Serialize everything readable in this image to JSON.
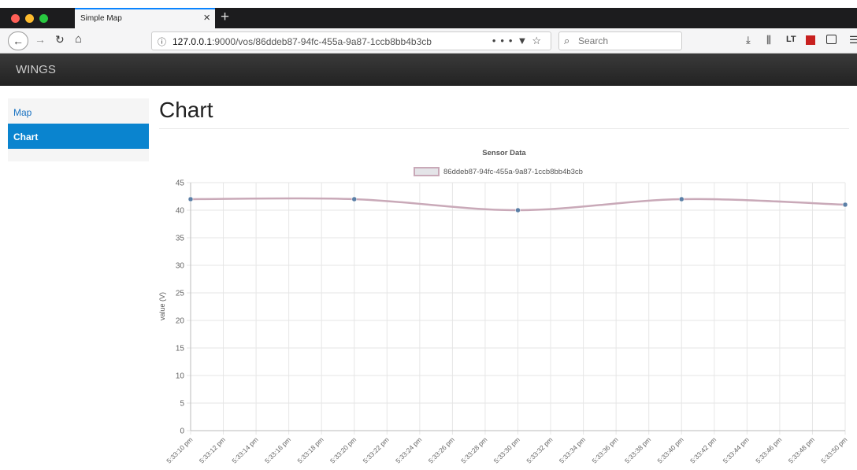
{
  "browser": {
    "tab_title": "Simple Map",
    "tab_close": "×",
    "new_tab": "+",
    "url_host": "127.0.0.1",
    "url_rest": ":9000/vos/86ddeb87-94fc-455a-9a87-1ccb8bb4b3cb",
    "search_placeholder": "Search",
    "traffic_colors": [
      "#ff5f57",
      "#febc2e",
      "#28c840"
    ]
  },
  "app": {
    "brand": "WINGS"
  },
  "sidebar": {
    "items": [
      {
        "label": "Map"
      },
      {
        "label": "Chart"
      }
    ]
  },
  "main": {
    "title": "Chart"
  },
  "chart_data": {
    "type": "line",
    "title": "Sensor Data",
    "ylabel": "value (V)",
    "xlabel": "",
    "ylim": [
      0,
      45
    ],
    "y_ticks": [
      0,
      5,
      10,
      15,
      20,
      25,
      30,
      35,
      40,
      45
    ],
    "x_ticks": [
      "5:33:10 pm",
      "5:33:12 pm",
      "5:33:14 pm",
      "5:33:16 pm",
      "5:33:18 pm",
      "5:33:20 pm",
      "5:33:22 pm",
      "5:33:24 pm",
      "5:33:26 pm",
      "5:33:28 pm",
      "5:33:30 pm",
      "5:33:32 pm",
      "5:33:34 pm",
      "5:33:36 pm",
      "5:33:38 pm",
      "5:33:40 pm",
      "5:33:42 pm",
      "5:33:44 pm",
      "5:33:46 pm",
      "5:33:48 pm",
      "5:33:50 pm"
    ],
    "grid": true,
    "legend_position": "top",
    "series": [
      {
        "name": "86ddeb87-94fc-455a-9a87-1ccb8bb4b3cb",
        "color": "#c9a9b8",
        "point_color": "#5b7fa6",
        "points": [
          {
            "x": "5:33:10 pm",
            "y": 42
          },
          {
            "x": "5:33:20 pm",
            "y": 42
          },
          {
            "x": "5:33:30 pm",
            "y": 40
          },
          {
            "x": "5:33:40 pm",
            "y": 42
          },
          {
            "x": "5:33:50 pm",
            "y": 41
          }
        ]
      }
    ]
  }
}
